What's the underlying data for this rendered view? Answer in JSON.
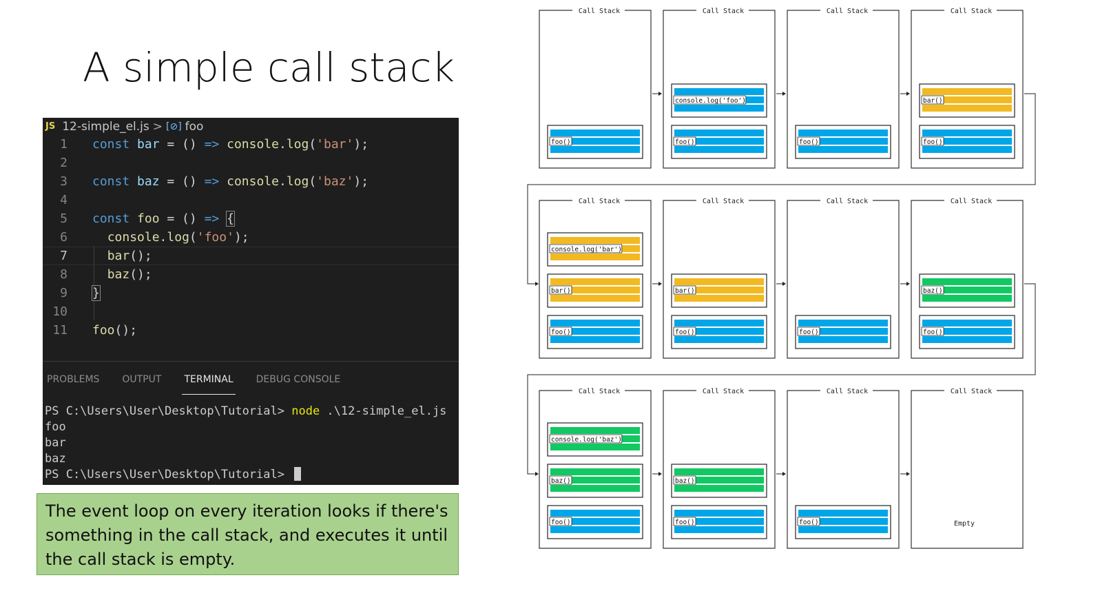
{
  "slide": {
    "title": "A simple call stack",
    "note": "The event loop on every iteration looks if there's something in the call stack, and executes it until the call stack is empty."
  },
  "editor": {
    "file_badge": "JS",
    "file_name": "12-simple_el.js",
    "breadcrumb_separator": ">",
    "symbol_icon": "symbol-variable-icon",
    "symbol_name": "foo",
    "lines": [
      {
        "n": "1",
        "tokens": [
          [
            "kw",
            "const "
          ],
          [
            "var",
            "bar"
          ],
          [
            "p",
            " = () "
          ],
          [
            "kw",
            "=>"
          ],
          [
            "p",
            " "
          ],
          [
            "fn",
            "console"
          ],
          [
            "p",
            "."
          ],
          [
            "fn",
            "log"
          ],
          [
            "p",
            "("
          ],
          [
            "str",
            "'bar'"
          ],
          [
            "p",
            ");"
          ]
        ]
      },
      {
        "n": "2",
        "tokens": []
      },
      {
        "n": "3",
        "tokens": [
          [
            "kw",
            "const "
          ],
          [
            "var",
            "baz"
          ],
          [
            "p",
            " = () "
          ],
          [
            "kw",
            "=>"
          ],
          [
            "p",
            " "
          ],
          [
            "fn",
            "console"
          ],
          [
            "p",
            "."
          ],
          [
            "fn",
            "log"
          ],
          [
            "p",
            "("
          ],
          [
            "str",
            "'baz'"
          ],
          [
            "p",
            ");"
          ]
        ]
      },
      {
        "n": "4",
        "tokens": []
      },
      {
        "n": "5",
        "tokens": [
          [
            "kw",
            "const "
          ],
          [
            "fn",
            "foo"
          ],
          [
            "p",
            " = () "
          ],
          [
            "kw",
            "=>"
          ],
          [
            "p",
            " "
          ],
          [
            "br",
            "{"
          ]
        ]
      },
      {
        "n": "6",
        "tokens": [
          [
            "p",
            "  "
          ],
          [
            "fn",
            "console"
          ],
          [
            "p",
            "."
          ],
          [
            "fn",
            "log"
          ],
          [
            "p",
            "("
          ],
          [
            "str",
            "'foo'"
          ],
          [
            "p",
            ");"
          ]
        ]
      },
      {
        "n": "7",
        "tokens": [
          [
            "p",
            "  "
          ],
          [
            "fn",
            "bar"
          ],
          [
            "p",
            "();"
          ]
        ],
        "current": true
      },
      {
        "n": "8",
        "tokens": [
          [
            "p",
            "  "
          ],
          [
            "fn",
            "baz"
          ],
          [
            "p",
            "();"
          ]
        ]
      },
      {
        "n": "9",
        "tokens": [
          [
            "br",
            "}"
          ]
        ]
      },
      {
        "n": "10",
        "tokens": []
      },
      {
        "n": "11",
        "tokens": [
          [
            "fn",
            "foo"
          ],
          [
            "p",
            "();"
          ]
        ]
      }
    ]
  },
  "panel": {
    "tabs": [
      {
        "label": "PROBLEMS",
        "active": false
      },
      {
        "label": "OUTPUT",
        "active": false
      },
      {
        "label": "TERMINAL",
        "active": true
      },
      {
        "label": "DEBUG CONSOLE",
        "active": false
      }
    ],
    "terminal": {
      "prompt": "PS C:\\Users\\User\\Desktop\\Tutorial> ",
      "command": "node",
      "command_args": " .\\12-simple_el.js",
      "output": [
        "foo",
        "bar",
        "baz"
      ],
      "final_prompt": "PS C:\\Users\\User\\Desktop\\Tutorial> "
    }
  },
  "diagram": {
    "panel_label": "Call Stack",
    "empty_label": "Empty",
    "colors": {
      "blue": "#00a6e8",
      "yellow": "#f2b922",
      "green": "#12c862",
      "frame": "#333333"
    },
    "rows": [
      [
        [
          {
            "label": "foo()",
            "color": "blue"
          }
        ],
        [
          {
            "label": "console.log('foo')",
            "color": "blue"
          },
          {
            "label": "foo()",
            "color": "blue"
          }
        ],
        [
          {
            "label": "foo()",
            "color": "blue"
          }
        ],
        [
          {
            "label": "bar()",
            "color": "yellow"
          },
          {
            "label": "foo()",
            "color": "blue"
          }
        ]
      ],
      [
        [
          {
            "label": "console.log('bar')",
            "color": "yellow"
          },
          {
            "label": "bar()",
            "color": "yellow"
          },
          {
            "label": "foo()",
            "color": "blue"
          }
        ],
        [
          {
            "label": "bar()",
            "color": "yellow"
          },
          {
            "label": "foo()",
            "color": "blue"
          }
        ],
        [
          {
            "label": "foo()",
            "color": "blue"
          }
        ],
        [
          {
            "label": "baz()",
            "color": "green"
          },
          {
            "label": "foo()",
            "color": "blue"
          }
        ]
      ],
      [
        [
          {
            "label": "console.log('baz')",
            "color": "green"
          },
          {
            "label": "baz()",
            "color": "green"
          },
          {
            "label": "foo()",
            "color": "blue"
          }
        ],
        [
          {
            "label": "baz()",
            "color": "green"
          },
          {
            "label": "foo()",
            "color": "blue"
          }
        ],
        [
          {
            "label": "foo()",
            "color": "blue"
          }
        ],
        []
      ]
    ]
  }
}
